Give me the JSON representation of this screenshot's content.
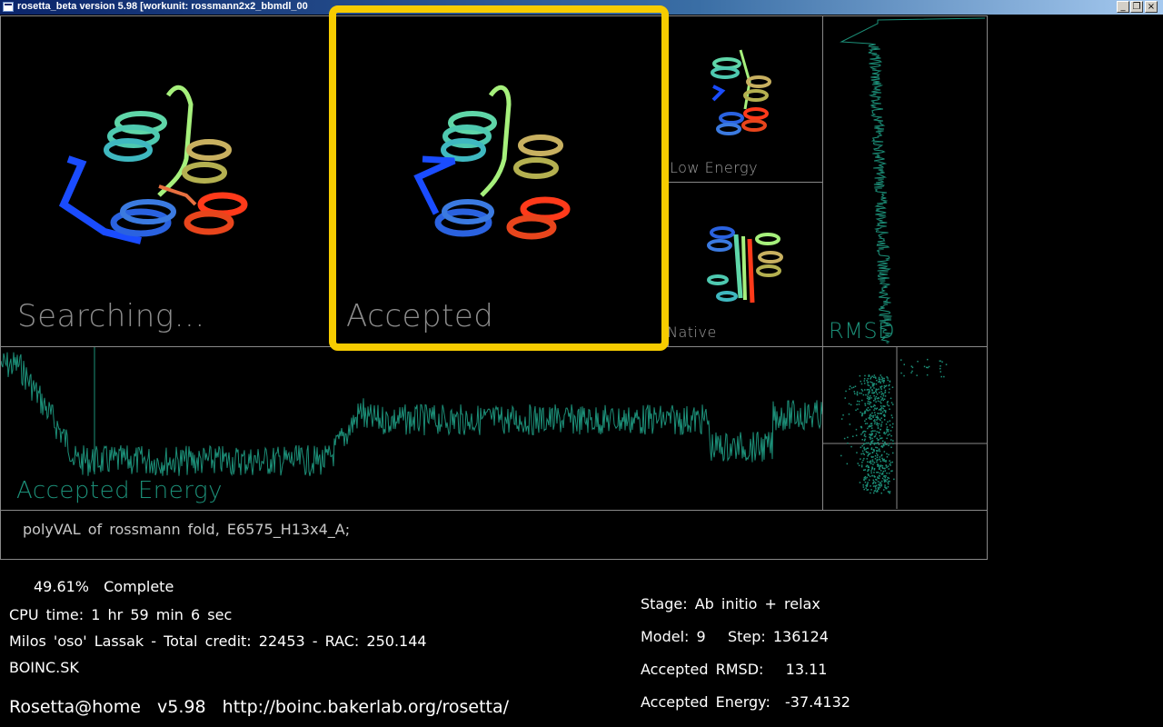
{
  "window": {
    "title": "rosetta_beta version 5.98 [workunit: rossmann2x2_bbmdl_00",
    "buttons": [
      "_",
      "❐",
      "×"
    ]
  },
  "panels": {
    "searching_label": "Searching...",
    "accepted_label": "Accepted",
    "low_energy_label": "Low Energy",
    "native_label": "Native",
    "rmsd_label": "RMSD",
    "accepted_energy_label": "Accepted Energy"
  },
  "description": "polyVAL of rossmann fold, E6575_H13x4_A;",
  "status": {
    "complete": "49.61%  Complete",
    "cpu_time": "CPU time: 1 hr 59 min 6 sec",
    "user_credit": "Milos 'oso' Lassak - Total credit: 22453 - RAC: 250.144",
    "team": "BOINC.SK",
    "app": "Rosetta@home  v5.98  http://boinc.bakerlab.org/rosetta/",
    "stage": "Stage: Ab initio + relax",
    "model_step": "Model: 9   Step: 136124",
    "accepted_rmsd": "Accepted RMSD:   13.11",
    "accepted_energy": "Accepted Energy:  -37.4132"
  },
  "colors": {
    "trace": "#1c8f78",
    "highlight": "#f7cc00",
    "border": "#888888"
  }
}
